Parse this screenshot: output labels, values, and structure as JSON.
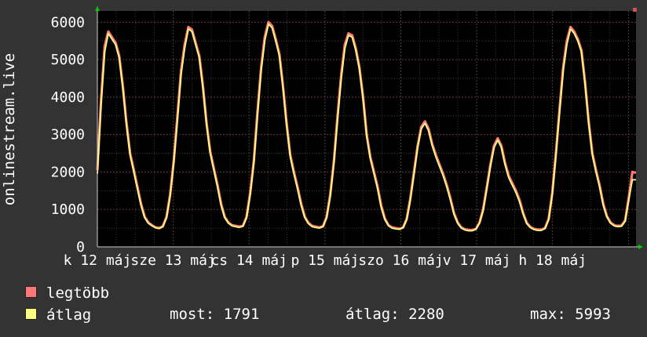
{
  "chart_data": {
    "type": "line",
    "ylabel": "onlinestream.live",
    "ylim": [
      0,
      6300
    ],
    "yticks": [
      0,
      1000,
      2000,
      3000,
      4000,
      5000,
      6000
    ],
    "grid": true,
    "x_tick_labels": [
      "k 12 máj",
      "sze 13 máj",
      "cs 14 máj",
      "p 15 máj",
      "szo 16 máj",
      "v 17 máj",
      "h 18 máj"
    ],
    "series": [
      {
        "name": "legtöbb",
        "color": "#ff7777",
        "values": [
          2050,
          3900,
          5350,
          5750,
          5600,
          5450,
          5100,
          4300,
          3300,
          2500,
          2050,
          1600,
          1150,
          800,
          650,
          580,
          520,
          500,
          550,
          800,
          1400,
          2300,
          3500,
          4700,
          5400,
          5870,
          5800,
          5450,
          5100,
          4300,
          3300,
          2550,
          2100,
          1650,
          1150,
          800,
          650,
          580,
          560,
          540,
          560,
          800,
          1450,
          2300,
          3600,
          4800,
          5600,
          6000,
          5900,
          5550,
          5150,
          4300,
          3300,
          2450,
          2000,
          1600,
          1150,
          800,
          640,
          560,
          540,
          520,
          550,
          800,
          1400,
          2300,
          3500,
          4600,
          5400,
          5700,
          5650,
          5300,
          4800,
          4000,
          3000,
          2400,
          2000,
          1600,
          1100,
          750,
          580,
          520,
          500,
          480,
          520,
          750,
          1300,
          2000,
          2700,
          3200,
          3350,
          3150,
          2750,
          2450,
          2200,
          1950,
          1650,
          1300,
          900,
          650,
          520,
          470,
          450,
          450,
          480,
          650,
          1000,
          1600,
          2200,
          2700,
          2900,
          2700,
          2250,
          1900,
          1700,
          1500,
          1250,
          900,
          640,
          530,
          480,
          460,
          460,
          500,
          750,
          1450,
          2500,
          3700,
          4800,
          5500,
          5870,
          5750,
          5550,
          5250,
          4400,
          3350,
          2500,
          2050,
          1650,
          1150,
          820,
          650,
          580,
          560,
          570,
          700,
          1300,
          2000,
          1980
        ]
      },
      {
        "name": "átlag",
        "color": "#ffff80",
        "values": [
          1950,
          3750,
          5200,
          5700,
          5550,
          5400,
          5050,
          4250,
          3250,
          2450,
          2000,
          1550,
          1100,
          780,
          630,
          560,
          510,
          490,
          540,
          780,
          1350,
          2250,
          3400,
          4600,
          5300,
          5820,
          5750,
          5400,
          5050,
          4250,
          3250,
          2500,
          2050,
          1600,
          1100,
          780,
          630,
          560,
          540,
          520,
          550,
          780,
          1400,
          2250,
          3500,
          4700,
          5500,
          5950,
          5850,
          5500,
          5100,
          4250,
          3250,
          2400,
          1950,
          1550,
          1100,
          780,
          620,
          540,
          520,
          500,
          540,
          780,
          1350,
          2250,
          3400,
          4500,
          5300,
          5650,
          5600,
          5250,
          4750,
          3950,
          2950,
          2350,
          1950,
          1550,
          1050,
          730,
          560,
          500,
          480,
          470,
          510,
          730,
          1250,
          1950,
          2650,
          3150,
          3300,
          3100,
          2700,
          2400,
          2150,
          1900,
          1600,
          1250,
          870,
          630,
          500,
          450,
          430,
          430,
          470,
          630,
          970,
          1550,
          2150,
          2650,
          2850,
          2650,
          2200,
          1850,
          1650,
          1450,
          1200,
          870,
          620,
          510,
          460,
          440,
          440,
          490,
          730,
          1400,
          2450,
          3600,
          4700,
          5400,
          5820,
          5700,
          5500,
          5200,
          4350,
          3300,
          2450,
          2000,
          1600,
          1100,
          800,
          630,
          560,
          540,
          550,
          680,
          1250,
          1791,
          1791
        ]
      }
    ]
  },
  "legend": {
    "items": [
      {
        "label": "legtöbb",
        "color": "#ff7777"
      },
      {
        "label": "átlag",
        "color": "#ffff80"
      }
    ]
  },
  "stats": {
    "now": "most: 1791",
    "avg": "átlag: 2280",
    "max": "max: 5993"
  }
}
